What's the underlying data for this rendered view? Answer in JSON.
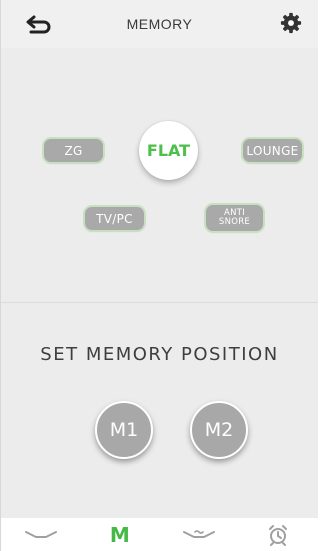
{
  "header": {
    "title": "MEMORY",
    "back_icon": "back-arrow-icon",
    "settings_icon": "gear-icon"
  },
  "presets": {
    "flat": "FLAT",
    "zg": "ZG",
    "lounge": "LOUNGE",
    "tv_pc": "TV/PC",
    "anti_snore_line1": "ANTI",
    "anti_snore_line2": "SNORE"
  },
  "memory": {
    "label": "SET MEMORY POSITION",
    "m1": "M1",
    "m2": "M2"
  },
  "bottom_nav": {
    "items": [
      {
        "icon": "bed-position-icon",
        "label": ""
      },
      {
        "icon": "memory-icon",
        "label": "M"
      },
      {
        "icon": "massage-icon",
        "label": ""
      },
      {
        "icon": "alarm-clock-icon",
        "label": ""
      }
    ],
    "active_color": "#44b947",
    "inactive_color": "#999999"
  },
  "colors": {
    "accent": "#4cc04a",
    "pill_bg": "#a9a9a9",
    "panel_bg": "#ececec"
  }
}
